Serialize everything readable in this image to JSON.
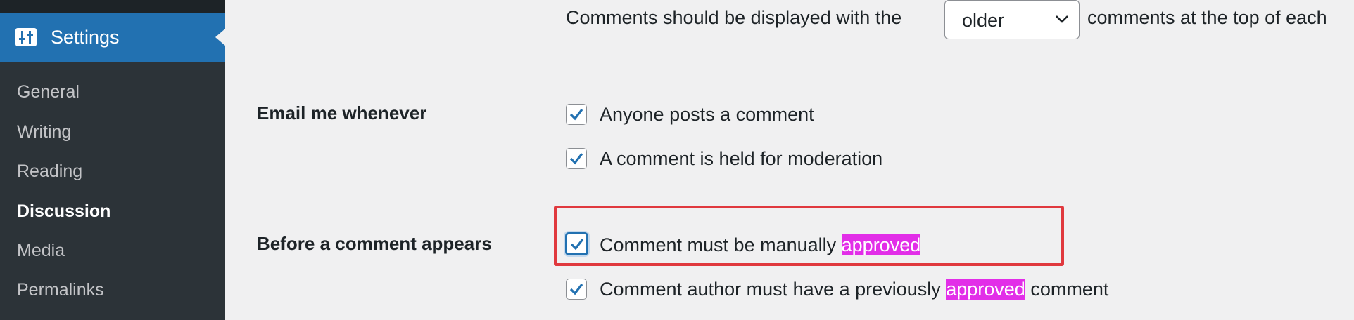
{
  "sidebar": {
    "current_menu": {
      "label": "Settings",
      "icon": "settings-sliders-icon"
    },
    "items": [
      {
        "label": "General"
      },
      {
        "label": "Writing"
      },
      {
        "label": "Reading"
      },
      {
        "label": "Discussion",
        "current": true
      },
      {
        "label": "Media"
      },
      {
        "label": "Permalinks"
      }
    ]
  },
  "main": {
    "comment_order": {
      "prefix": "Comments should be displayed with the",
      "selected": "older",
      "suffix": "comments at the top of each"
    },
    "email_me": {
      "label": "Email me whenever",
      "options": [
        {
          "label": "Anyone posts a comment",
          "checked": true
        },
        {
          "label": "A comment is held for moderation",
          "checked": true
        }
      ]
    },
    "before_comment": {
      "label": "Before a comment appears",
      "options": [
        {
          "pre": "Comment must be manually ",
          "highlight": "approved",
          "post": "",
          "checked": true
        },
        {
          "pre": "Comment author must have a previously ",
          "highlight": "approved",
          "post": " comment",
          "checked": true
        }
      ]
    }
  },
  "colors": {
    "sidebar_bg": "#2c3338",
    "active_menu_bg": "#2271b1",
    "highlight": "#e22ee8",
    "annotation_box": "#e0393e",
    "check": "#2271b1"
  }
}
